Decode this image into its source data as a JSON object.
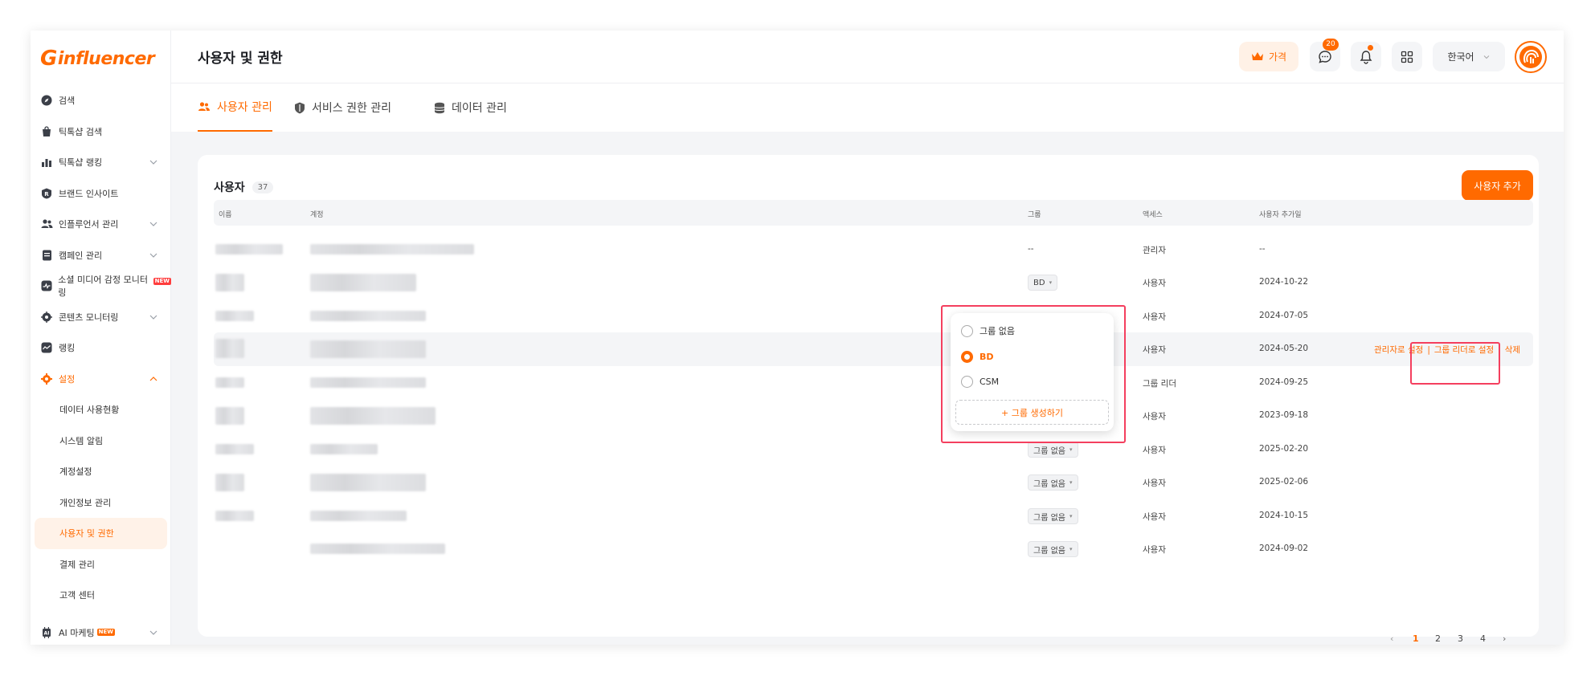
{
  "app": {
    "logo_text": "influencer",
    "logo_initial": "G"
  },
  "sidebar": {
    "items": [
      {
        "label": "검색",
        "icon": "compass-icon"
      },
      {
        "label": "틱톡샵 검색",
        "icon": "shopping-bag-icon"
      },
      {
        "label": "틱톡샵 랭킹",
        "icon": "bar-chart-icon",
        "expandable": true
      },
      {
        "label": "브랜드 인사이트",
        "icon": "brand-r-icon"
      },
      {
        "label": "인플루언서 관리",
        "icon": "users-icon",
        "expandable": true
      },
      {
        "label": "캠페인 관리",
        "icon": "document-icon",
        "expandable": true
      },
      {
        "label": "소셜 미디어 감정 모니터링",
        "icon": "pulse-icon",
        "badge": "NEW"
      },
      {
        "label": "콘텐츠 모니터링",
        "icon": "monitor-icon",
        "expandable": true
      },
      {
        "label": "랭킹",
        "icon": "ranking-icon"
      },
      {
        "label": "설정",
        "icon": "gear-icon",
        "expandable": true,
        "expanded": true
      }
    ],
    "settings_sub": [
      {
        "label": "데이터 사용현황"
      },
      {
        "label": "시스템 알림"
      },
      {
        "label": "계정설정"
      },
      {
        "label": "개인정보 관리"
      },
      {
        "label": "사용자 및 권한",
        "active": true
      },
      {
        "label": "결제 관리"
      },
      {
        "label": "고객 센터"
      }
    ],
    "ai": {
      "label": "AI 마케팅",
      "badge": "NEW"
    }
  },
  "header": {
    "title": "사용자 및 권한",
    "price_label": "가격",
    "message_count": "20",
    "language": "한국어"
  },
  "tabs": [
    {
      "label": "사용자 관리",
      "active": true
    },
    {
      "label": "서비스 권한 관리"
    },
    {
      "label": "데이터 관리"
    }
  ],
  "users": {
    "title": "사용자",
    "count": "37",
    "add_button": "사용자 추가",
    "columns": {
      "name": "이름",
      "account": "계정",
      "group": "그룹",
      "access": "액세스",
      "added": "사용자 추가일"
    },
    "rows": [
      {
        "group": "--",
        "access": "관리자",
        "date": "--"
      },
      {
        "group": "BD",
        "access": "사용자",
        "date": "2024-10-22"
      },
      {
        "group": "",
        "access": "사용자",
        "date": "2024-07-05"
      },
      {
        "group": "",
        "access": "사용자",
        "date": "2024-05-20"
      },
      {
        "group": "",
        "access": "그룹 리더",
        "date": "2024-09-25"
      },
      {
        "group": "",
        "access": "사용자",
        "date": "2023-09-18"
      },
      {
        "group": "그룹 없음",
        "access": "사용자",
        "date": "2025-02-20"
      },
      {
        "group": "그룹 없음",
        "access": "사용자",
        "date": "2025-02-06"
      },
      {
        "group": "그룹 없음",
        "access": "사용자",
        "date": "2024-10-15"
      },
      {
        "group": "그룹 없음",
        "access": "사용자",
        "date": "2024-09-02"
      }
    ],
    "row_actions": {
      "set_admin": "관리자로 설정",
      "set_leader": "그룹 리더로 설정",
      "delete": "삭제"
    }
  },
  "group_dropdown": {
    "options": [
      {
        "label": "그룹 없음",
        "selected": false
      },
      {
        "label": "BD",
        "selected": true
      },
      {
        "label": "CSM",
        "selected": false
      }
    ],
    "create_label": "+ 그룹 생성하기"
  },
  "pagination": {
    "pages": [
      "1",
      "2",
      "3",
      "4"
    ],
    "current": "1"
  },
  "colors": {
    "accent": "#ff6a00",
    "highlight_box": "#f43f5e"
  }
}
